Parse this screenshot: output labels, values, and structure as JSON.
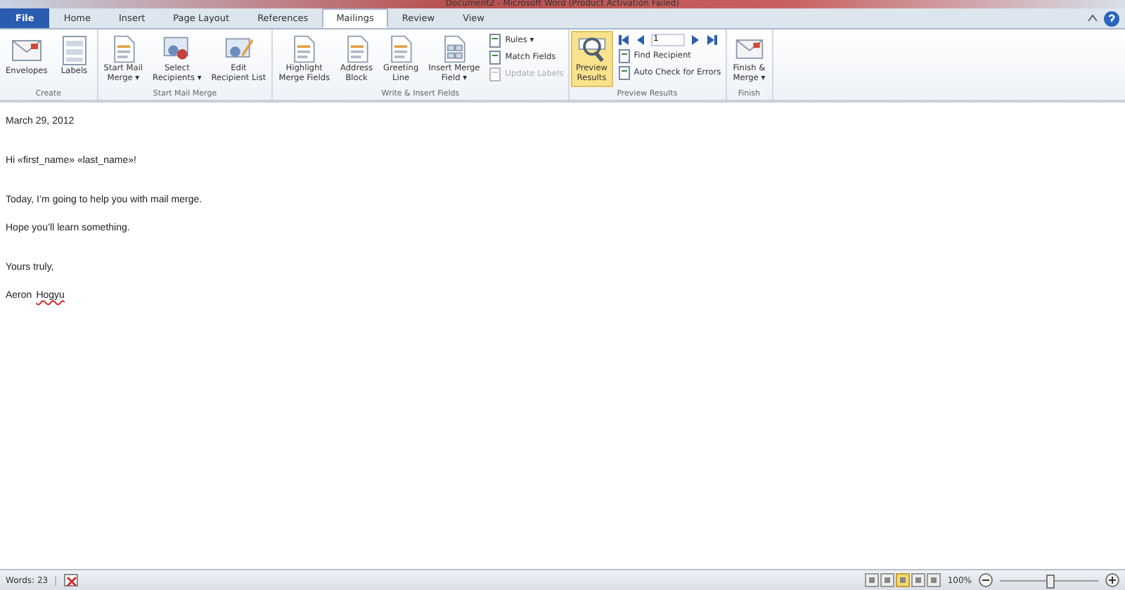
{
  "window": {
    "title": "Document2 - Microsoft Word (Product Activation Failed)"
  },
  "tabs": [
    {
      "label": "File",
      "kind": "file",
      "selected": false
    },
    {
      "label": "Home",
      "kind": "tab",
      "selected": false
    },
    {
      "label": "Insert",
      "kind": "tab",
      "selected": false
    },
    {
      "label": "Page Layout",
      "kind": "tab",
      "selected": false
    },
    {
      "label": "References",
      "kind": "tab",
      "selected": false
    },
    {
      "label": "Mailings",
      "kind": "tab",
      "selected": true
    },
    {
      "label": "Review",
      "kind": "tab",
      "selected": false
    },
    {
      "label": "View",
      "kind": "tab",
      "selected": false
    }
  ],
  "ribbon_groups": [
    {
      "label": "Create",
      "items": [
        {
          "kind": "large",
          "lines": [
            "Envelopes"
          ],
          "active": false
        },
        {
          "kind": "large",
          "lines": [
            "Labels"
          ],
          "active": false
        }
      ]
    },
    {
      "label": "Start Mail Merge",
      "items": [
        {
          "kind": "large",
          "lines": [
            "Start Mail",
            "Merge ▾"
          ],
          "active": false
        },
        {
          "kind": "large",
          "lines": [
            "Select",
            "Recipients ▾"
          ],
          "active": false
        },
        {
          "kind": "large",
          "lines": [
            "Edit",
            "Recipient List"
          ],
          "active": false
        }
      ]
    },
    {
      "label": "Write & Insert Fields",
      "items": [
        {
          "kind": "large",
          "lines": [
            "Highlight",
            "Merge Fields"
          ],
          "active": false
        },
        {
          "kind": "large",
          "lines": [
            "Address",
            "Block"
          ],
          "active": false
        },
        {
          "kind": "large",
          "lines": [
            "Greeting",
            "Line"
          ],
          "active": false
        },
        {
          "kind": "large",
          "lines": [
            "Insert Merge",
            "Field ▾"
          ],
          "active": false
        },
        {
          "kind": "stack",
          "rows": [
            {
              "label": "Rules ▾",
              "disabled": false
            },
            {
              "label": "Match Fields",
              "disabled": false
            },
            {
              "label": "Update Labels",
              "disabled": true
            }
          ]
        }
      ]
    },
    {
      "label": "Preview Results",
      "items": [
        {
          "kind": "large",
          "lines": [
            "Preview",
            "Results"
          ],
          "active": true
        },
        {
          "kind": "nav",
          "record": "1",
          "rows": [
            {
              "label": "Find Recipient",
              "disabled": false
            },
            {
              "label": "Auto Check for Errors",
              "disabled": false
            }
          ]
        }
      ]
    },
    {
      "label": "Finish",
      "items": [
        {
          "kind": "large",
          "lines": [
            "Finish &",
            "Merge ▾"
          ],
          "active": false
        }
      ]
    }
  ],
  "document": {
    "sections": [
      [
        {
          "kind": "text",
          "text": "March 29, 2012"
        }
      ],
      [
        {
          "kind": "text",
          "text": "Hi «first_name» «last_name»!"
        }
      ],
      [
        {
          "kind": "text",
          "text": "Today, I’m going to help you with mail merge."
        },
        {
          "kind": "text",
          "text": "Hope you’ll learn something."
        }
      ],
      [
        {
          "kind": "text",
          "text": "Yours truly,"
        },
        {
          "kind": "signature",
          "first": "Aeron",
          "last": "Hogyu"
        }
      ]
    ]
  },
  "status_bar": {
    "words": "Words: 23",
    "zoom": "100%"
  }
}
